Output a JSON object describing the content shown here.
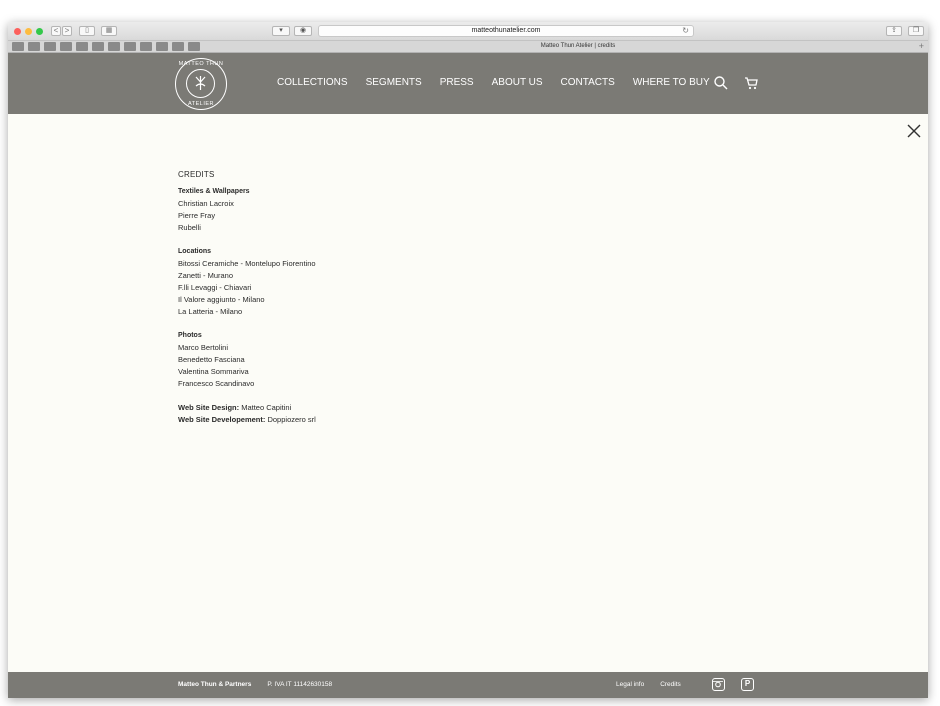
{
  "browser": {
    "url": "matteothunatelier.com",
    "tab_title": "Matteo Thun Atelier | credits",
    "back_label": "<",
    "forward_label": ">"
  },
  "logo": {
    "top_text": "MATTEO THUN",
    "bottom_text": "ATELIER"
  },
  "nav": {
    "items": [
      "COLLECTIONS",
      "SEGMENTS",
      "PRESS",
      "ABOUT US",
      "CONTACTS",
      "WHERE TO BUY"
    ]
  },
  "credits": {
    "title": "CREDITS",
    "sections": [
      {
        "heading": "Textiles & Wallpapers",
        "items": [
          "Christian Lacroix",
          "Pierre Fray",
          "Rubelli"
        ]
      },
      {
        "heading": "Locations",
        "items": [
          "Bitossi Ceramiche - Montelupo Fiorentino",
          "Zanetti - Murano",
          "F.lli Levaggi - Chiavari",
          "Il Valore aggiunto - Milano",
          "La Latteria - Milano"
        ]
      },
      {
        "heading": "Photos",
        "items": [
          "Marco Bertolini",
          "Benedetto Fasciana",
          "Valentina Sommariva",
          "Francesco Scandinavo"
        ]
      }
    ],
    "web_design_label": "Web Site Design:",
    "web_design_value": " Matteo Capitini",
    "web_dev_label": "Web Site Developement:",
    "web_dev_value": " Doppiozero srl"
  },
  "footer": {
    "company": "Matteo Thun & Partners",
    "vat": "P. IVA IT 11142630158",
    "legal_label": "Legal info",
    "credits_label": "Credits",
    "pinterest_glyph": "P"
  }
}
